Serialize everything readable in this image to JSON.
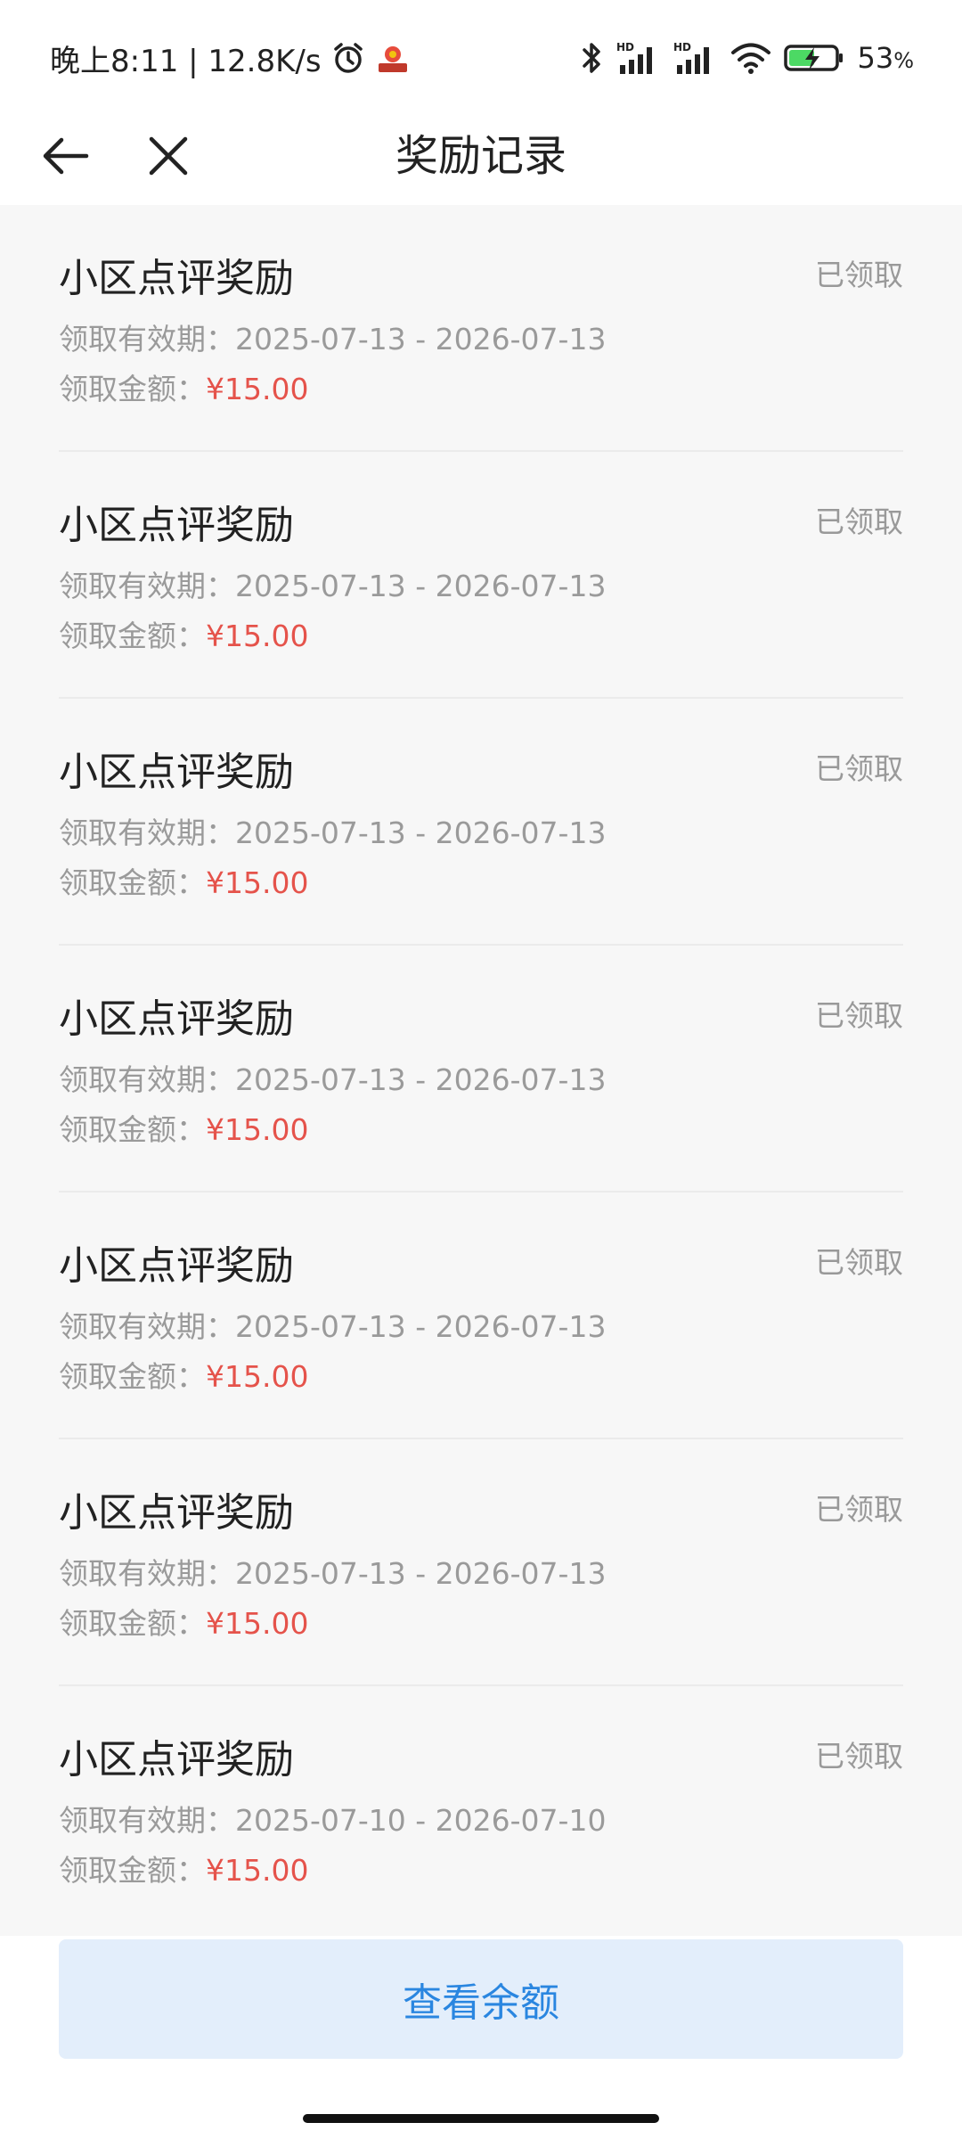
{
  "status_bar": {
    "time_speed": "晚上8:11 | 12.8K/s",
    "battery_percent": "53",
    "battery_unit": "%",
    "icons": [
      "alarm-icon",
      "app-notification-icon",
      "bluetooth-icon",
      "hd-signal-icon",
      "hd-signal-icon",
      "wifi-icon",
      "battery-charging-icon"
    ]
  },
  "header": {
    "title": "奖励记录",
    "icons": [
      "back-arrow-icon",
      "close-icon"
    ]
  },
  "records": [
    {
      "title": "小区点评奖励",
      "status": "已领取",
      "validity_label": "领取有效期：",
      "validity": "2025-07-13 - 2026-07-13",
      "amount_label": "领取金额：",
      "amount": "¥15.00"
    },
    {
      "title": "小区点评奖励",
      "status": "已领取",
      "validity_label": "领取有效期：",
      "validity": "2025-07-13 - 2026-07-13",
      "amount_label": "领取金额：",
      "amount": "¥15.00"
    },
    {
      "title": "小区点评奖励",
      "status": "已领取",
      "validity_label": "领取有效期：",
      "validity": "2025-07-13 - 2026-07-13",
      "amount_label": "领取金额：",
      "amount": "¥15.00"
    },
    {
      "title": "小区点评奖励",
      "status": "已领取",
      "validity_label": "领取有效期：",
      "validity": "2025-07-13 - 2026-07-13",
      "amount_label": "领取金额：",
      "amount": "¥15.00"
    },
    {
      "title": "小区点评奖励",
      "status": "已领取",
      "validity_label": "领取有效期：",
      "validity": "2025-07-13 - 2026-07-13",
      "amount_label": "领取金额：",
      "amount": "¥15.00"
    },
    {
      "title": "小区点评奖励",
      "status": "已领取",
      "validity_label": "领取有效期：",
      "validity": "2025-07-13 - 2026-07-13",
      "amount_label": "领取金额：",
      "amount": "¥15.00"
    },
    {
      "title": "小区点评奖励",
      "status": "已领取",
      "validity_label": "领取有效期：",
      "validity": "2025-07-10 - 2026-07-10",
      "amount_label": "领取金额：",
      "amount": "¥15.00"
    }
  ],
  "bottom": {
    "button_label": "查看余额"
  },
  "colors": {
    "amount": "#e5534b",
    "button_bg": "#e3eefb",
    "button_text": "#2a86e0",
    "muted_text": "#9a9a9a"
  }
}
